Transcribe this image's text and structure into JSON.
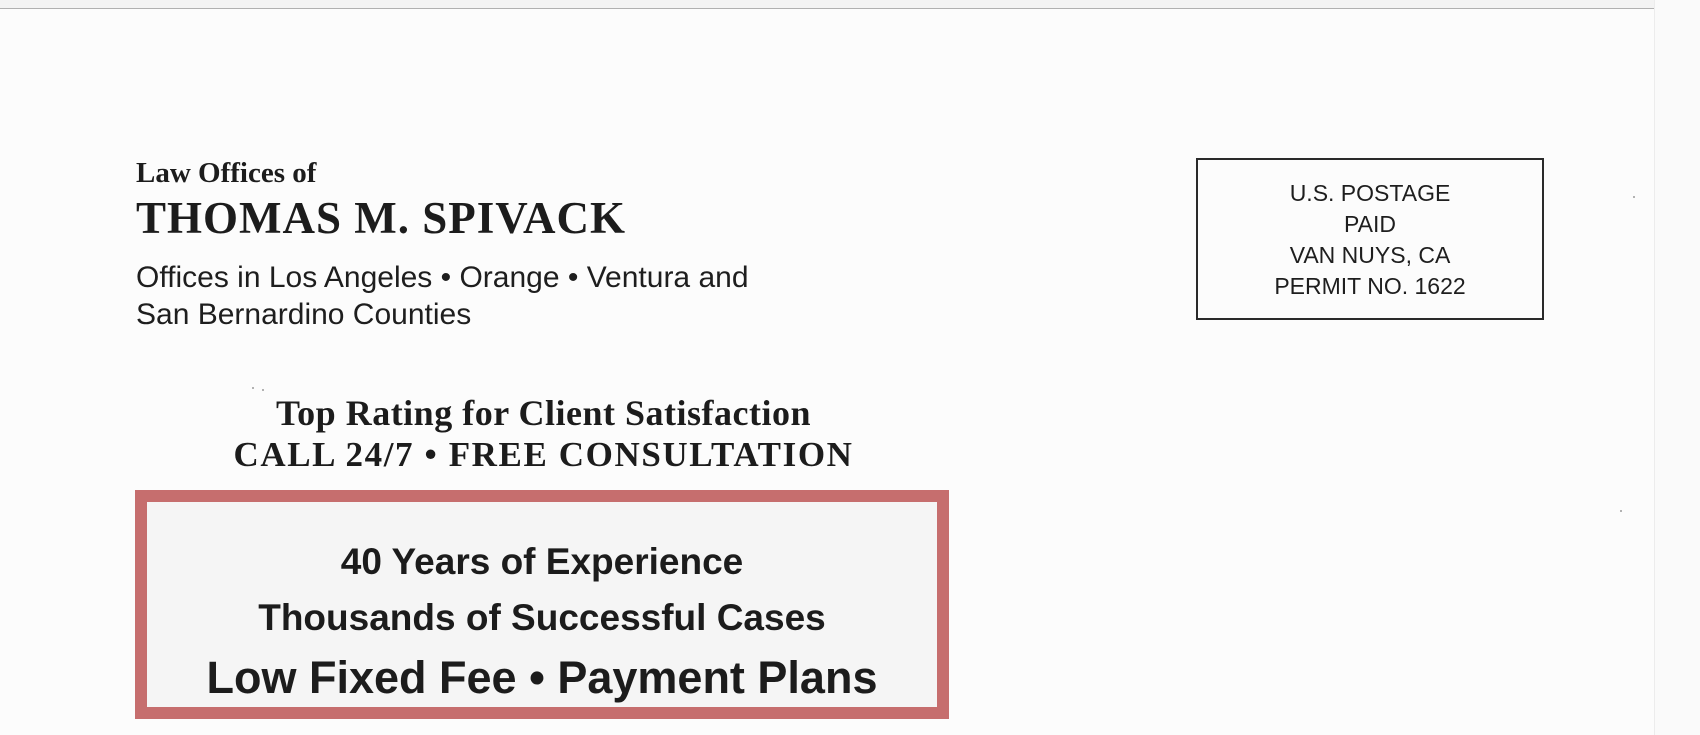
{
  "return_address": {
    "law_offices_of": "Law Offices of",
    "firm_name": "THOMAS M. SPIVACK",
    "offices_line_1": "Offices in Los Angeles • Orange • Ventura and",
    "offices_line_2": "San Bernardino Counties"
  },
  "tagline": {
    "line_1": "Top Rating for Client Satisfaction",
    "line_2": "CALL 24/7 • FREE CONSULTATION"
  },
  "highlight_box": {
    "line_1": "40 Years of Experience",
    "line_2": "Thousands of Successful Cases",
    "line_3": "Low Fixed Fee • Payment Plans"
  },
  "postage": {
    "line_1": "U.S. POSTAGE",
    "line_2": "PAID",
    "line_3": "VAN NUYS, CA",
    "line_4": "PERMIT NO. 1622"
  },
  "colors": {
    "box_border": "#c66e6e",
    "text": "#1c1c1c",
    "paper": "#fcfcfc"
  }
}
